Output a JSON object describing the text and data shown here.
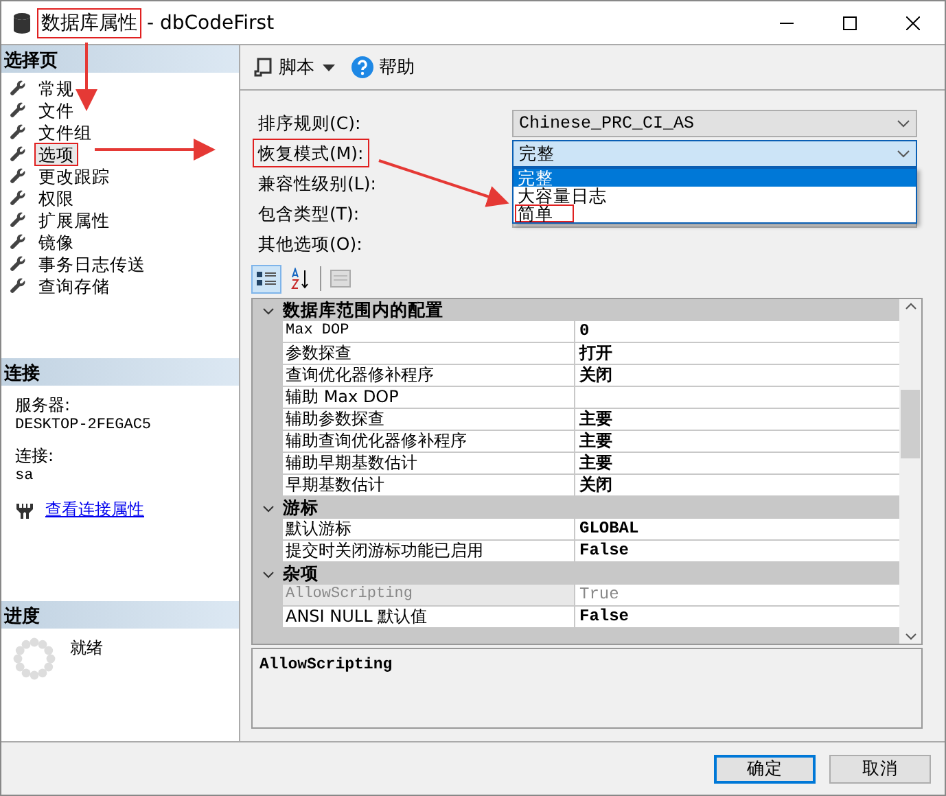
{
  "window": {
    "title": "数据库属性",
    "title_annotated": true,
    "subtitle": "- dbCodeFirst"
  },
  "left": {
    "page_header": "选择页",
    "pages": [
      {
        "label": "常规",
        "selected": false,
        "annotated": false
      },
      {
        "label": "文件",
        "selected": false,
        "annotated": false
      },
      {
        "label": "文件组",
        "selected": false,
        "annotated": false
      },
      {
        "label": "选项",
        "selected": true,
        "annotated": true
      },
      {
        "label": "更改跟踪",
        "selected": false,
        "annotated": false
      },
      {
        "label": "权限",
        "selected": false,
        "annotated": false
      },
      {
        "label": "扩展属性",
        "selected": false,
        "annotated": false
      },
      {
        "label": "镜像",
        "selected": false,
        "annotated": false
      },
      {
        "label": "事务日志传送",
        "selected": false,
        "annotated": false
      },
      {
        "label": "查询存储",
        "selected": false,
        "annotated": false
      }
    ],
    "connection": {
      "header": "连接",
      "server_label": "服务器:",
      "server": "DESKTOP-2FEGAC5",
      "login_label": "连接:",
      "login": "sa",
      "link": "查看连接属性"
    },
    "progress": {
      "header": "进度",
      "status": "就绪"
    }
  },
  "toolbar": {
    "script": "脚本",
    "help": "帮助"
  },
  "fields": [
    {
      "label": "排序规则(C):",
      "value": "Chinese_PRC_CI_AS",
      "annotated": false,
      "focused": false
    },
    {
      "label": "恢复模式(M):",
      "value": "完整",
      "annotated": true,
      "focused": true,
      "options": [
        {
          "label": "完整",
          "selected": true,
          "annotated": false
        },
        {
          "label": "大容量日志",
          "selected": false,
          "annotated": false
        },
        {
          "label": "简单",
          "selected": false,
          "annotated": true
        }
      ]
    },
    {
      "label": "兼容性级别(L):",
      "annotated": false
    },
    {
      "label": "包含类型(T):",
      "annotated": false,
      "focused": false
    }
  ],
  "other_options": "其他选项(O):",
  "grid_toolbar": [
    {
      "kind": "categorized",
      "selected": true
    },
    {
      "kind": "alphabetical",
      "selected": false
    },
    {
      "kind": "pages",
      "selected": false
    }
  ],
  "grid": [
    {
      "name": "数据库范围内的配置",
      "expanded": true,
      "rows": [
        {
          "name": "Max DOP",
          "value": "0",
          "disabled": false
        },
        {
          "name": "参数探查",
          "value": "打开",
          "disabled": false
        },
        {
          "name": "查询优化器修补程序",
          "value": "关闭",
          "disabled": false
        },
        {
          "name": "辅助 Max DOP",
          "disabled": false
        },
        {
          "name": "辅助参数探查",
          "value": "主要",
          "disabled": false
        },
        {
          "name": "辅助查询优化器修补程序",
          "value": "主要",
          "disabled": false
        },
        {
          "name": "辅助早期基数估计",
          "value": "主要",
          "disabled": false
        },
        {
          "name": "早期基数估计",
          "value": "关闭",
          "disabled": false
        }
      ]
    },
    {
      "name": "游标",
      "expanded": true,
      "rows": [
        {
          "name": "默认游标",
          "value": "GLOBAL",
          "disabled": false
        },
        {
          "name": "提交时关闭游标功能已启用",
          "value": "False",
          "disabled": false
        }
      ]
    },
    {
      "name": "杂项",
      "expanded": true,
      "rows": [
        {
          "name": "AllowScripting",
          "value": "True",
          "disabled": true
        },
        {
          "name": "ANSI NULL 默认值",
          "value": "False",
          "disabled": false
        }
      ]
    }
  ],
  "description": "AllowScripting",
  "buttons": [
    {
      "label": "确定",
      "default": true
    },
    {
      "label": "取消",
      "default": false
    }
  ]
}
